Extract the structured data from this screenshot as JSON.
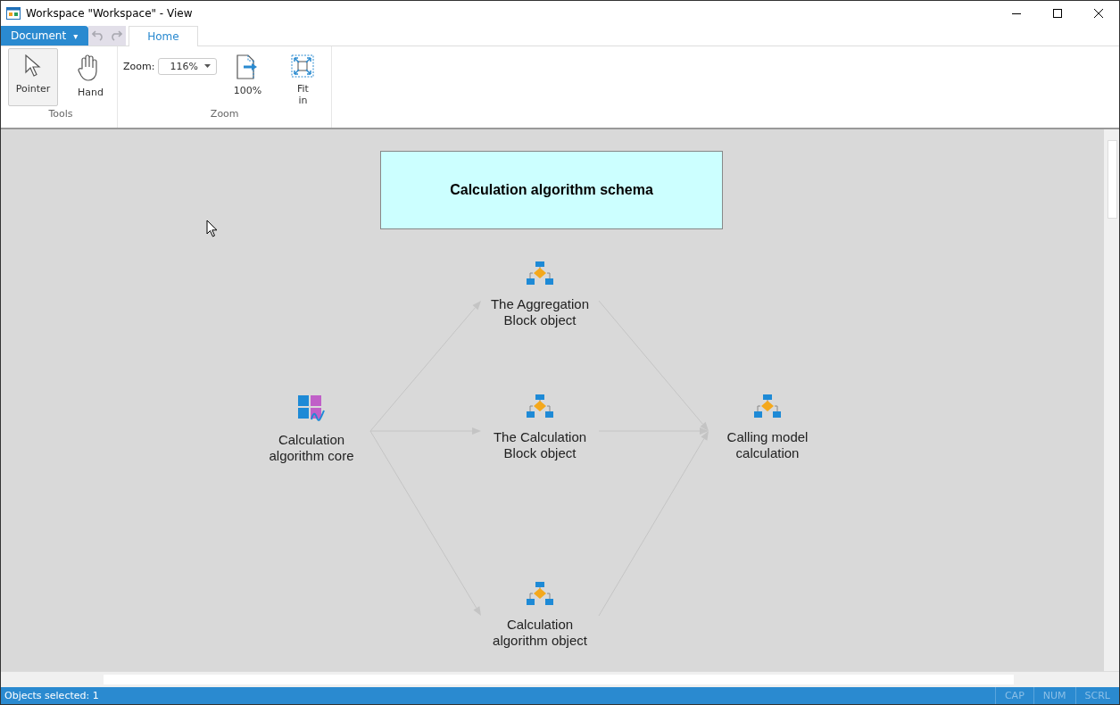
{
  "window": {
    "title": "Workspace \"Workspace\" - View"
  },
  "menu": {
    "label": "Document",
    "caret": "▾"
  },
  "tabs": [
    {
      "label": "Home",
      "selected": true
    }
  ],
  "ribbon": {
    "groups": [
      {
        "title": "Tools",
        "items": [
          {
            "kind": "pointer",
            "label": "Pointer",
            "selected": true
          },
          {
            "kind": "hand",
            "label": "Hand",
            "selected": false
          }
        ]
      },
      {
        "title": "Zoom",
        "zoom_label": "Zoom:",
        "zoom_value": "116%",
        "items": [
          {
            "kind": "actual",
            "label": "100%",
            "selected": false
          },
          {
            "kind": "fit",
            "label": "Fit in",
            "selected": false
          }
        ]
      }
    ]
  },
  "diagram": {
    "title": "Calculation algorithm schema",
    "nodes": [
      {
        "kind": "model",
        "label": "Calculation algorithm core"
      },
      {
        "kind": "block",
        "label": "The Aggregation Block object"
      },
      {
        "kind": "block",
        "label": "The Calculation Block object"
      },
      {
        "kind": "block",
        "label": "Calculation algorithm object"
      },
      {
        "kind": "block",
        "label": "Calling model calculation"
      }
    ]
  },
  "status_bar": {
    "text": "Objects selected: 1",
    "indicators": [
      {
        "label": "CAP",
        "on": false
      },
      {
        "label": "NUM",
        "on": false
      },
      {
        "label": "SCRL",
        "on": false
      }
    ]
  }
}
